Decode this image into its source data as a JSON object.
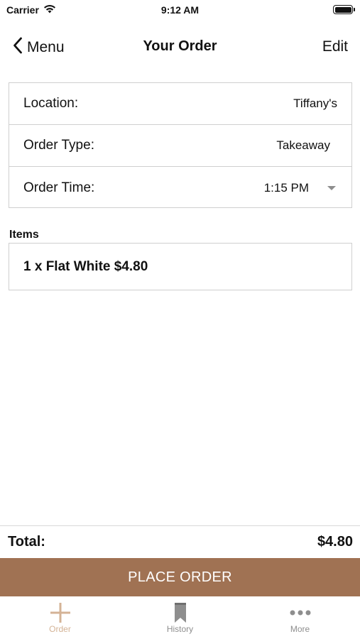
{
  "status_bar": {
    "carrier": "Carrier",
    "time": "9:12 AM"
  },
  "nav": {
    "back_label": "Menu",
    "title": "Your Order",
    "edit_label": "Edit"
  },
  "order_details": [
    {
      "label": "Location:",
      "value": "Tiffany's"
    },
    {
      "label": "Order Type:",
      "value": "Takeaway"
    },
    {
      "label": "Order Time:",
      "value": "1:15 PM"
    }
  ],
  "items": {
    "heading": "Items",
    "lines": [
      "1 x Flat White $4.80"
    ]
  },
  "total": {
    "label": "Total:",
    "amount": "$4.80"
  },
  "place_order_label": "PLACE ORDER",
  "tabs": [
    {
      "label": "Order",
      "icon": "plus-icon",
      "active": true
    },
    {
      "label": "History",
      "icon": "bookmark-icon",
      "active": false
    },
    {
      "label": "More",
      "icon": "more-dots-icon",
      "active": false
    }
  ],
  "colors": {
    "accent": "#a07253",
    "tab_active": "#d4b396",
    "tab_inactive": "#8e8e8e",
    "border": "#cfcfcf"
  }
}
